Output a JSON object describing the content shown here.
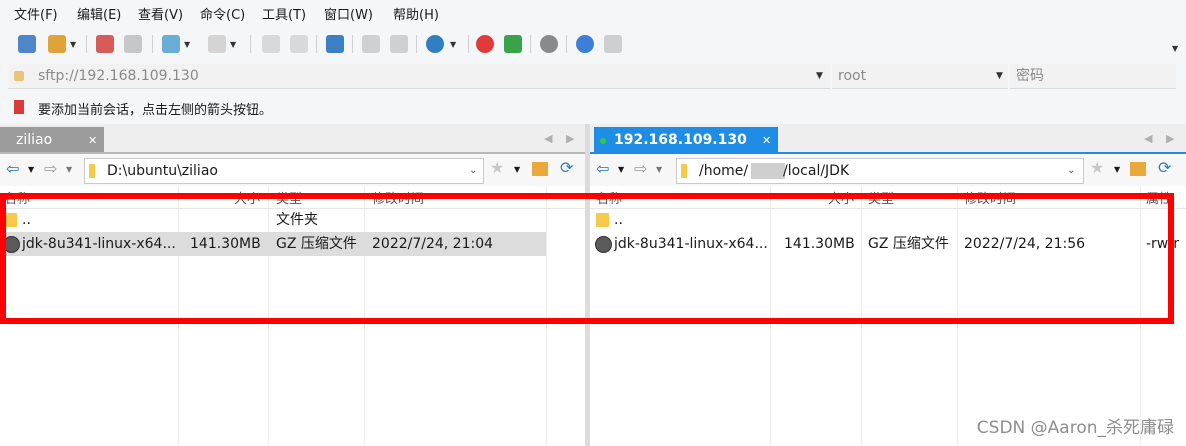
{
  "menubar": {
    "items": [
      "文件(F)",
      "编辑(E)",
      "查看(V)",
      "命令(C)",
      "工具(T)",
      "窗口(W)",
      "帮助(H)"
    ]
  },
  "address": {
    "url": "sftp://192.168.109.130",
    "user": "root",
    "password": "密码"
  },
  "hint": {
    "text": "要添加当前会话，点击左侧的箭头按钮。"
  },
  "left_pane": {
    "tab_label": "ziliao",
    "path": "D:\\ubuntu\\ziliao",
    "columns": [
      "名称",
      "大小",
      "类型",
      "修改时间"
    ],
    "rows": [
      {
        "name": "..",
        "size": "",
        "type": "文件夹",
        "modified": ""
      },
      {
        "name": "jdk-8u341-linux-x64...",
        "size": "141.30MB",
        "type": "GZ 压缩文件",
        "modified": "2022/7/24, 21:04"
      }
    ]
  },
  "right_pane": {
    "tab_label": "192.168.109.130",
    "path_prefix": "/home/",
    "path_suffix": "/local/JDK",
    "columns": [
      "名称",
      "大小",
      "类型",
      "修改时间",
      "属性"
    ],
    "rows": [
      {
        "name": "..",
        "size": "",
        "type": "",
        "modified": "",
        "attrs": ""
      },
      {
        "name": "jdk-8u341-linux-x64...",
        "size": "141.30MB",
        "type": "GZ 压缩文件",
        "modified": "2022/7/24, 21:56",
        "attrs": "-rw-r"
      }
    ]
  },
  "watermark": "CSDN @Aaron_杀死庸碌",
  "colors": {
    "accent": "#1f8ce6",
    "highlight": "#ff0000",
    "tab_active": "#1f8ce6"
  }
}
